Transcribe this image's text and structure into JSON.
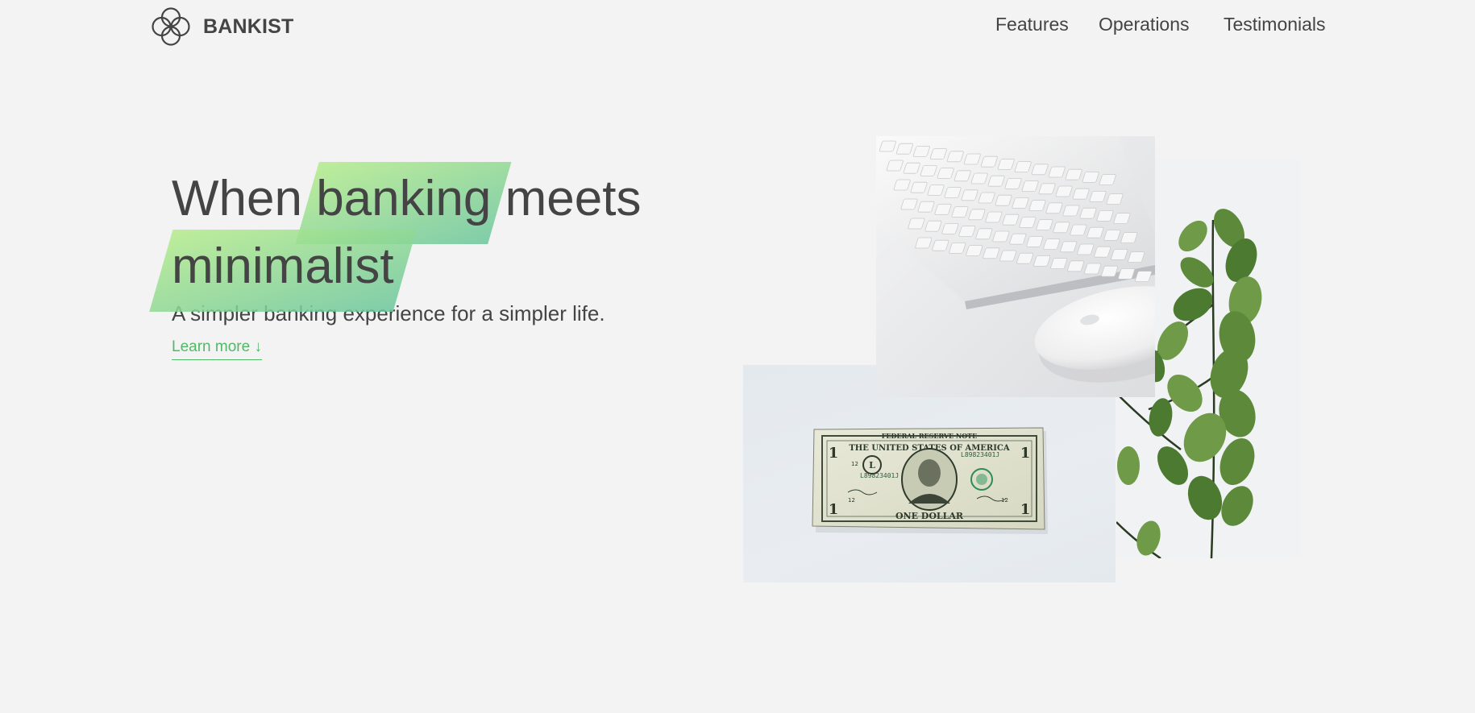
{
  "brand": {
    "name": "BANKIST",
    "logo_icon": "four-rings-icon"
  },
  "nav": {
    "items": [
      {
        "label": "Features"
      },
      {
        "label": "Operations"
      },
      {
        "label": "Testimonials"
      }
    ]
  },
  "hero": {
    "title_part1": "When",
    "title_highlight1": "banking",
    "title_part2": "meets",
    "title_highlight2": "minimalist",
    "subtitle": "A simpler banking experience for a simpler life.",
    "learn_more": "Learn more ↓"
  },
  "colors": {
    "background": "#f3f3f3",
    "text": "#444444",
    "accent_green": "#51b868",
    "highlight_start": "#b5ec8b",
    "highlight_end": "#6cc69d"
  },
  "images": {
    "keyboard": "keyboard-mouse-photo",
    "plant": "eucalyptus-plant-photo",
    "dollar": "one-dollar-bill-photo"
  },
  "dollar_bill": {
    "top_banner": "FEDERAL RESERVE NOTE",
    "country": "THE UNITED STATES OF AMERICA",
    "serial": "L89823401J",
    "bottom_banner": "ONE DOLLAR",
    "denomination": "1",
    "district_letter": "L",
    "district_number": "12"
  }
}
